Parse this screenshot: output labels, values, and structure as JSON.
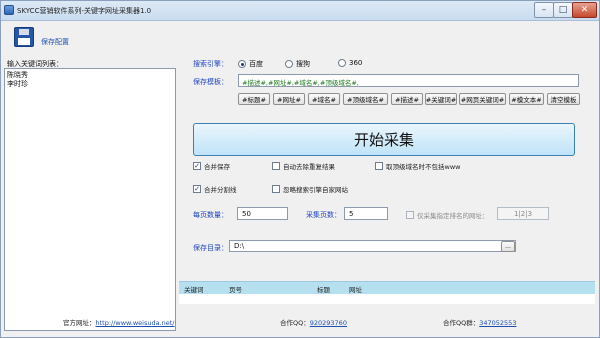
{
  "window": {
    "title": "SKYCC营销软件系列-关键字网址采集器1.0",
    "minimize_icon": "minimize-icon",
    "maximize_icon": "maximize-icon",
    "close_icon": "close-icon"
  },
  "toolbar": {
    "save_config_label": "保存配置",
    "save_icon": "floppy-disk-icon"
  },
  "keywords": {
    "title": "输入关键词列表：",
    "items": [
      "陈晓秀",
      "李时珍"
    ]
  },
  "search_engine": {
    "label": "搜索引擎：",
    "options": [
      {
        "label": "百度",
        "selected": true
      },
      {
        "label": "搜狗",
        "selected": false
      },
      {
        "label": "360",
        "selected": false
      }
    ]
  },
  "template": {
    "label": "保存模板：",
    "value": "#描述#,#网址#,#域名#,#顶级域名#,",
    "tags": [
      "#标题#",
      "#网址#",
      "#域名#",
      "#顶级域名#",
      "#描述#",
      "#关键词#",
      "#网页关键词#",
      "#模文本#",
      "清空模板"
    ]
  },
  "start_button": {
    "label": "开始采集"
  },
  "options": {
    "merge_save": {
      "label": "合并保存",
      "checked": true
    },
    "auto_dedupe": {
      "label": "自动去除重复结果",
      "checked": false
    },
    "top_domain_no_www": {
      "label": "取顶级域名时不包括www",
      "checked": false
    },
    "merge_split": {
      "label": "合并分割线",
      "checked": true
    },
    "ignore_own_site": {
      "label": "忽略搜索引擎自家网站",
      "checked": false
    }
  },
  "per_page": {
    "label": "每页数量：",
    "value": "50"
  },
  "pages": {
    "label": "采集页数：",
    "value": "5"
  },
  "specified_rank": {
    "label": "仅采集指定排名的网址：",
    "value": "1|2|3",
    "checked": false
  },
  "save_dir": {
    "label": "保存目录：",
    "value": "D:\\",
    "browse_label": "..."
  },
  "results": {
    "columns": [
      "关键词",
      "页号",
      "标题",
      "网址"
    ]
  },
  "footer": {
    "site_label": "官方网址：",
    "site_url": "http://www.weisuda.net/",
    "qq_label": "合作QQ：",
    "qq_value": "920293760",
    "group_label": "合作QQ群：",
    "group_value": "347052553"
  },
  "colors": {
    "accent_blue": "#1e45c0",
    "start_button_bg": "#bfe3f8",
    "results_header_bg": "#b6e0ef",
    "template_text": "#1f7a1f"
  }
}
